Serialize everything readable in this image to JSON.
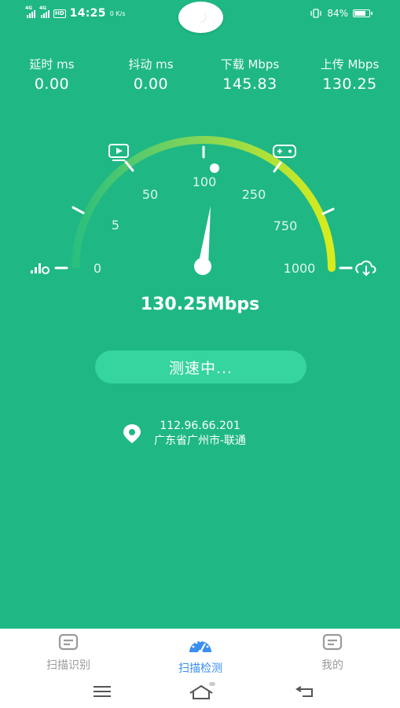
{
  "status_bar": {
    "network1": "4G",
    "network2": "4G",
    "hd": "HD",
    "time": "14:25",
    "speed_indicator": "0 K/s",
    "battery": "84%",
    "battery_level": 0.84
  },
  "theme": {
    "accent": "#1fb884",
    "button": "#36d49e",
    "active_tab": "#3a8ef0"
  },
  "metrics": [
    {
      "label": "延时 ms",
      "value": "0.00"
    },
    {
      "label": "抖动 ms",
      "value": "0.00"
    },
    {
      "label": "下载 Mbps",
      "value": "145.83"
    },
    {
      "label": "上传 Mbps",
      "value": "130.25"
    }
  ],
  "gauge": {
    "ticks": [
      "0",
      "5",
      "50",
      "100",
      "250",
      "750",
      "1000"
    ],
    "needle_value": "100",
    "icons": [
      "ping-icon",
      "video-icon",
      "game-icon",
      "cloud-download-icon"
    ]
  },
  "speed_readout": "130.25Mbps",
  "status_button": "测速中...",
  "location": {
    "ip": "112.96.66.201",
    "place": "广东省广州市-联通"
  },
  "tabs": [
    {
      "label": "扫描识别",
      "icon": "document-icon",
      "active": false
    },
    {
      "label": "扫描检测",
      "icon": "speedometer-icon",
      "active": true
    },
    {
      "label": "我的",
      "icon": "document-icon",
      "active": false
    }
  ]
}
